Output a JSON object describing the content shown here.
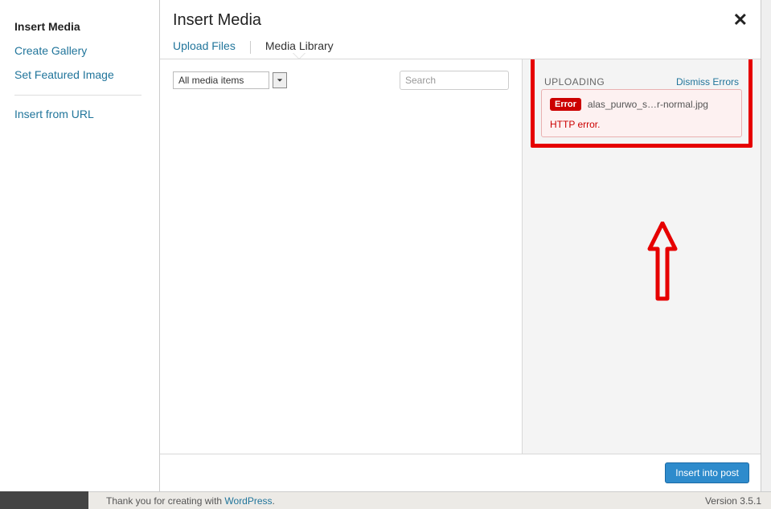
{
  "sidebar": {
    "items": [
      {
        "label": "Insert Media",
        "active": true
      },
      {
        "label": "Create Gallery",
        "active": false
      },
      {
        "label": "Set Featured Image",
        "active": false
      }
    ],
    "url_item": {
      "label": "Insert from URL"
    }
  },
  "header": {
    "title": "Insert Media"
  },
  "tabs": {
    "upload": "Upload Files",
    "library": "Media Library"
  },
  "toolbar": {
    "filter_value": "All media items",
    "search_placeholder": "Search"
  },
  "details": {
    "uploading_label": "UPLOADING",
    "dismiss_label": "Dismiss Errors",
    "error_badge": "Error",
    "error_filename": "alas_purwo_s…r-normal.jpg",
    "error_message": "HTTP error."
  },
  "footer": {
    "insert_label": "Insert into post"
  },
  "status": {
    "thanks_prefix": "Thank you for creating with ",
    "thanks_link": "WordPress",
    "thanks_suffix": ".",
    "version": "Version 3.5.1"
  }
}
